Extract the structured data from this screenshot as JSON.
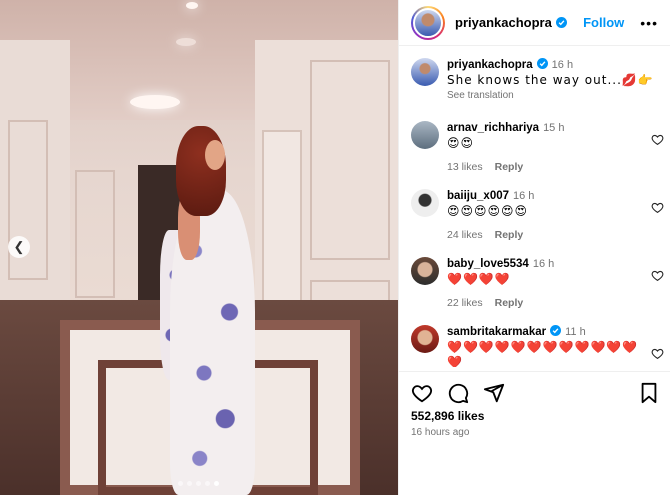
{
  "post": {
    "username": "priyankachopra",
    "follow_label": "Follow",
    "more_label": "•••",
    "caption_time": "16 h",
    "caption_text": "She knows the way out...💋👉",
    "see_translation": "See translation",
    "likes": "552,896 likes",
    "time_ago": "16 hours ago"
  },
  "comments": [
    {
      "username": "arnav_richhariya",
      "time": "15 h",
      "text": "😍😍",
      "likes": "13 likes",
      "reply": "Reply"
    },
    {
      "username": "baiiju_x007",
      "time": "16 h",
      "text": "😍😍😍😍😍😍",
      "likes": "24 likes",
      "reply": "Reply"
    },
    {
      "username": "baby_love5534",
      "time": "16 h",
      "text": "❤️❤️❤️❤️",
      "likes": "22 likes",
      "reply": "Reply"
    },
    {
      "username": "sambritakarmakar",
      "time": "11 h",
      "text": "❤️❤️❤️❤️❤️❤️❤️❤️❤️❤️❤️❤️❤️",
      "likes": "",
      "reply": ""
    }
  ],
  "colors": {
    "accent": "#0095f6",
    "muted": "#737373",
    "verified": "#0095f6"
  },
  "icons": [
    "heart-icon",
    "comment-icon",
    "share-icon",
    "bookmark-icon",
    "more-icon",
    "verified-icon",
    "chevron-left-icon"
  ]
}
